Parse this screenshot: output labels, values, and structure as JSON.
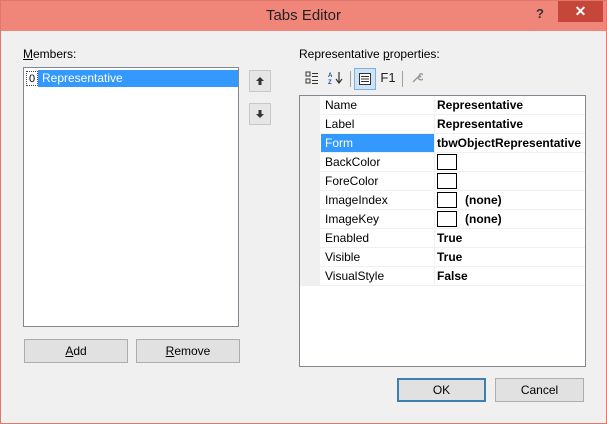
{
  "window": {
    "title": "Tabs Editor",
    "help_glyph": "?",
    "close_glyph": "✕"
  },
  "members": {
    "label": "Members:",
    "items": [
      {
        "index": "0",
        "name": "Representative"
      }
    ],
    "move_up_glyph": "🡅",
    "move_down_glyph": "🡇",
    "add_label": "Add",
    "remove_label": "Remove"
  },
  "properties": {
    "label": "Representative properties:",
    "toolbar": {
      "categorized_icon": "categorized-icon",
      "alphabetical_icon": "alphabetical-icon",
      "property_pages_icon": "property-pages-icon",
      "f1_label": "F1",
      "wrench_icon": "wrench-icon"
    },
    "rows": [
      {
        "name": "Name",
        "value": "Representative",
        "swatch": false
      },
      {
        "name": "Label",
        "value": "Representative",
        "swatch": false
      },
      {
        "name": "Form",
        "value": "tbwObjectRepresentative",
        "swatch": false,
        "selected": true
      },
      {
        "name": "BackColor",
        "value": "",
        "swatch": true
      },
      {
        "name": "ForeColor",
        "value": "",
        "swatch": true
      },
      {
        "name": "ImageIndex",
        "value": "(none)",
        "swatch": true
      },
      {
        "name": "ImageKey",
        "value": "(none)",
        "swatch": true
      },
      {
        "name": "Enabled",
        "value": "True",
        "swatch": false
      },
      {
        "name": "Visible",
        "value": "True",
        "swatch": false
      },
      {
        "name": "VisualStyle",
        "value": "False",
        "swatch": false
      }
    ]
  },
  "footer": {
    "ok_label": "OK",
    "cancel_label": "Cancel"
  },
  "colors": {
    "titlebar": "#f0867a",
    "close_button": "#c7463a",
    "selection": "#3399ff"
  }
}
